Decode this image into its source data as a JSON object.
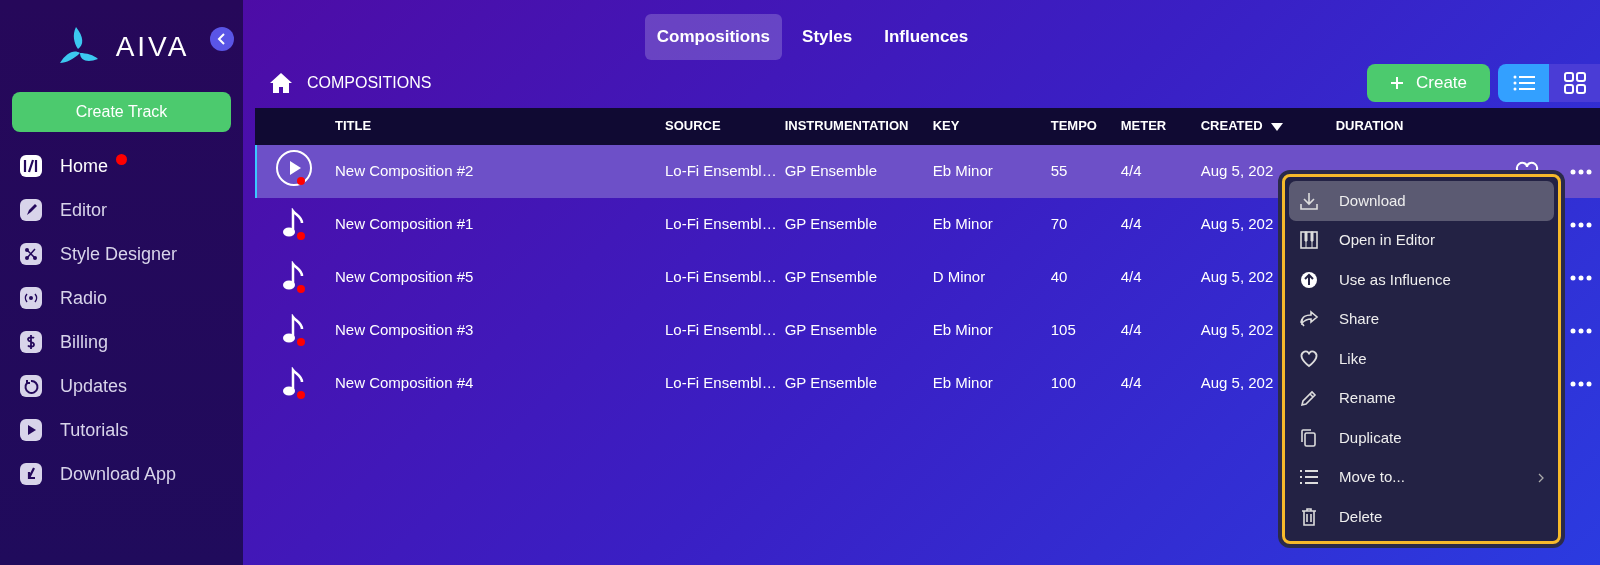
{
  "sidebar": {
    "logo": "AIVA",
    "create_button": "Create Track",
    "items": [
      {
        "label": "Home",
        "selected": true,
        "notification": true
      },
      {
        "label": "Editor",
        "selected": false,
        "notification": false
      },
      {
        "label": "Style Designer",
        "selected": false,
        "notification": false
      },
      {
        "label": "Radio",
        "selected": false,
        "notification": false
      },
      {
        "label": "Billing",
        "selected": false,
        "notification": false
      },
      {
        "label": "Updates",
        "selected": false,
        "notification": false
      },
      {
        "label": "Tutorials",
        "selected": false,
        "notification": false
      },
      {
        "label": "Download App",
        "selected": false,
        "notification": false
      }
    ]
  },
  "tabs": [
    {
      "label": "Compositions",
      "selected": true
    },
    {
      "label": "Styles",
      "selected": false
    },
    {
      "label": "Influences",
      "selected": false
    }
  ],
  "breadcrumb": "COMPOSITIONS",
  "create_button": "Create",
  "view_toggle": [
    {
      "kind": "list",
      "selected": true
    },
    {
      "kind": "grid",
      "selected": false
    }
  ],
  "table": {
    "columns": [
      {
        "label": "TITLE",
        "sorted": false
      },
      {
        "label": "SOURCE",
        "sorted": false
      },
      {
        "label": "INSTRUMENTATION",
        "sorted": false
      },
      {
        "label": "KEY",
        "sorted": false
      },
      {
        "label": "TEMPO",
        "sorted": false
      },
      {
        "label": "METER",
        "sorted": false
      },
      {
        "label": "CREATED",
        "sorted": true
      },
      {
        "label": "DURATION",
        "sorted": false
      }
    ],
    "rows": [
      {
        "selected": true,
        "new": true,
        "title": "New Composition #2",
        "source": "Lo-Fi Ensembl…",
        "instrumentation": "GP Ensemble",
        "key": "Eb Minor",
        "tempo": "55",
        "meter": "4/4",
        "created": "Aug 5, 202"
      },
      {
        "selected": false,
        "new": true,
        "title": "New Composition #1",
        "source": "Lo-Fi Ensembl…",
        "instrumentation": "GP Ensemble",
        "key": "Eb Minor",
        "tempo": "70",
        "meter": "4/4",
        "created": "Aug 5, 202"
      },
      {
        "selected": false,
        "new": true,
        "title": "New Composition #5",
        "source": "Lo-Fi Ensembl…",
        "instrumentation": "GP Ensemble",
        "key": "D Minor",
        "tempo": "40",
        "meter": "4/4",
        "created": "Aug 5, 202"
      },
      {
        "selected": false,
        "new": true,
        "title": "New Composition #3",
        "source": "Lo-Fi Ensembl…",
        "instrumentation": "GP Ensemble",
        "key": "Eb Minor",
        "tempo": "105",
        "meter": "4/4",
        "created": "Aug 5, 202"
      },
      {
        "selected": false,
        "new": true,
        "title": "New Composition #4",
        "source": "Lo-Fi Ensembl…",
        "instrumentation": "GP Ensemble",
        "key": "Eb Minor",
        "tempo": "100",
        "meter": "4/4",
        "created": "Aug 5, 202"
      }
    ]
  },
  "context_menu": [
    {
      "label": "Download",
      "selected": true,
      "submenu": false
    },
    {
      "label": "Open in Editor",
      "selected": false,
      "submenu": false
    },
    {
      "label": "Use as Influence",
      "selected": false,
      "submenu": false
    },
    {
      "label": "Share",
      "selected": false,
      "submenu": false
    },
    {
      "label": "Like",
      "selected": false,
      "submenu": false
    },
    {
      "label": "Rename",
      "selected": false,
      "submenu": false
    },
    {
      "label": "Duplicate",
      "selected": false,
      "submenu": false
    },
    {
      "label": "Move to...",
      "selected": false,
      "submenu": true
    },
    {
      "label": "Delete",
      "selected": false,
      "submenu": false
    }
  ]
}
